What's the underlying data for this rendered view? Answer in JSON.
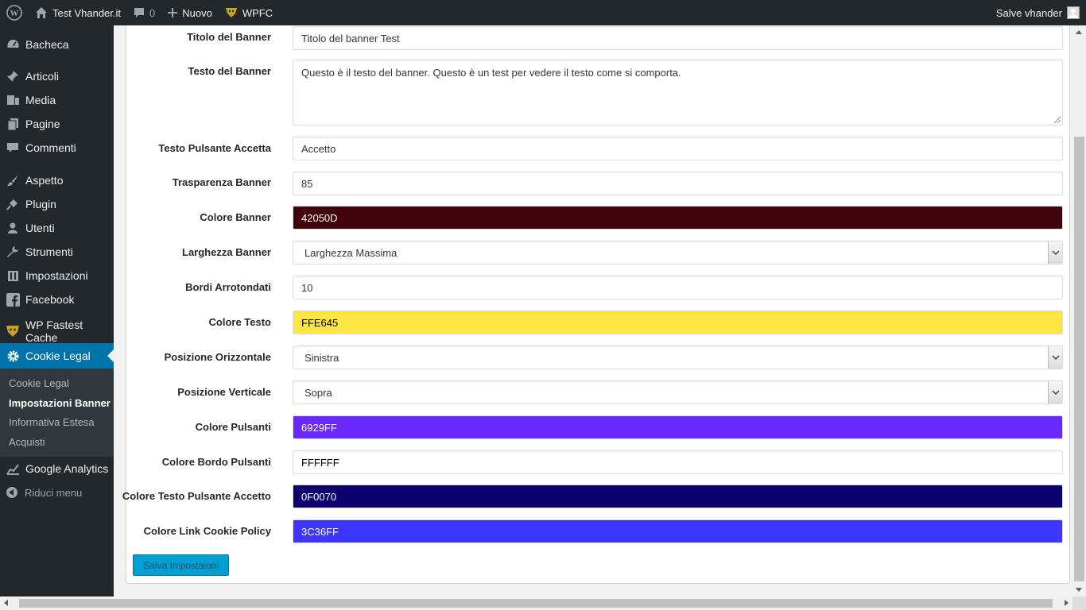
{
  "admin_bar": {
    "site_name": "Test Vhander.it",
    "comments_count": "0",
    "new_label": "Nuovo",
    "plugin_label": "WPFC",
    "greeting": "Salve vhander"
  },
  "sidebar": {
    "items": [
      {
        "label": "Bacheca",
        "icon": "dashboard-icon"
      },
      {
        "label": "Articoli",
        "icon": "pin-icon"
      },
      {
        "label": "Media",
        "icon": "media-icon"
      },
      {
        "label": "Pagine",
        "icon": "pages-icon"
      },
      {
        "label": "Commenti",
        "icon": "comments-icon"
      },
      {
        "label": "Aspetto",
        "icon": "brush-icon"
      },
      {
        "label": "Plugin",
        "icon": "plugin-icon"
      },
      {
        "label": "Utenti",
        "icon": "users-icon"
      },
      {
        "label": "Strumenti",
        "icon": "wrench-icon"
      },
      {
        "label": "Impostazioni",
        "icon": "settings-icon"
      },
      {
        "label": "Facebook",
        "icon": "facebook-icon"
      },
      {
        "label": "WP Fastest Cache",
        "icon": "cheetah-icon"
      },
      {
        "label": "Cookie Legal",
        "icon": "gear-icon"
      }
    ],
    "submenu": [
      {
        "label": "Cookie Legal"
      },
      {
        "label": "Impostazioni Banner"
      },
      {
        "label": "Informativa Estesa"
      },
      {
        "label": "Acquisti"
      }
    ],
    "after_items": [
      {
        "label": "Google Analytics",
        "icon": "analytics-icon"
      }
    ],
    "collapse_label": "Riduci menu"
  },
  "form": {
    "fields": [
      {
        "label": "Titolo del Banner",
        "value": "Titolo del banner Test",
        "type": "text"
      },
      {
        "label": "Testo del Banner",
        "value": "Questo è il testo del banner. Questo è un test per vedere il testo come si comporta.",
        "type": "textarea"
      },
      {
        "label": "Testo Pulsante Accetta",
        "value": "Accetto",
        "type": "text"
      },
      {
        "label": "Trasparenza Banner",
        "value": "85",
        "type": "text"
      },
      {
        "label": "Colore Banner",
        "value": "42050D",
        "type": "color",
        "bg": "#42050D",
        "fg": "#ffffff"
      },
      {
        "label": "Larghezza Banner",
        "value": "Larghezza Massima",
        "type": "select"
      },
      {
        "label": "Bordi Arrotondati",
        "value": "10",
        "type": "text"
      },
      {
        "label": "Colore Testo",
        "value": "FFE645",
        "type": "color",
        "bg": "#FFE645",
        "fg": "#000000"
      },
      {
        "label": "Posizione Orizzontale",
        "value": "Sinistra",
        "type": "select"
      },
      {
        "label": "Posizione Verticale",
        "value": "Sopra",
        "type": "select"
      },
      {
        "label": "Colore Pulsanti",
        "value": "6929FF",
        "type": "color",
        "bg": "#6929FF",
        "fg": "#ffffff"
      },
      {
        "label": "Colore Bordo Pulsanti",
        "value": "FFFFFF",
        "type": "color",
        "bg": "#FFFFFF",
        "fg": "#000000"
      },
      {
        "label": "Colore Testo Pulsante Accetto",
        "value": "0F0070",
        "type": "color",
        "bg": "#0F0070",
        "fg": "#ffffff"
      },
      {
        "label": "Colore Link Cookie Policy",
        "value": "3C36FF",
        "type": "color",
        "bg": "#3C36FF",
        "fg": "#ffffff"
      }
    ],
    "save_label": "Salva Impostaioni"
  },
  "colors": {
    "admin_bg": "#23282d",
    "accent": "#0073aa",
    "button": "#00a0d2"
  }
}
